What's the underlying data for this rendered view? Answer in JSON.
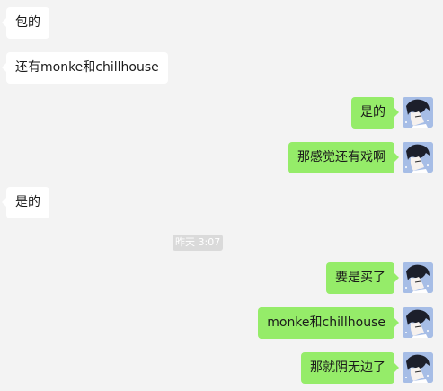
{
  "chat": {
    "messages": [
      {
        "side": "incoming",
        "text": "包的"
      },
      {
        "side": "incoming",
        "text": "还有monke和chillhouse"
      },
      {
        "side": "outgoing",
        "text": "是的"
      },
      {
        "side": "outgoing",
        "text": "那感觉还有戏啊"
      },
      {
        "side": "incoming",
        "text": "是的"
      },
      {
        "side": "outgoing",
        "text": "要是买了"
      },
      {
        "side": "outgoing",
        "text": "monke和chillhouse"
      },
      {
        "side": "outgoing",
        "text": "那就阴无边了"
      }
    ],
    "timestamp": "昨天 3:07"
  },
  "colors": {
    "background": "#f3f3f3",
    "incoming_bubble": "#ffffff",
    "outgoing_bubble": "#95ec69",
    "timestamp_bg": "#dadada"
  },
  "icons": {
    "avatar": "anime-boy-avatar-icon"
  }
}
